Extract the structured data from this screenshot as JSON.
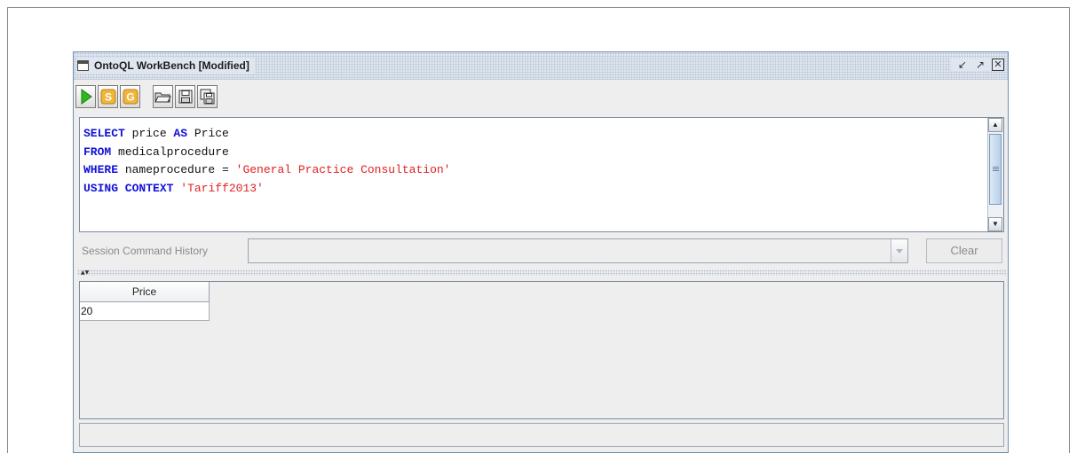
{
  "window": {
    "title": "OntoQL WorkBench [Modified]",
    "controls": {
      "minimize_icon": "restore-down-icon",
      "maximize_icon": "maximize-icon",
      "close_icon": "close-icon"
    }
  },
  "toolbar": {
    "buttons": [
      {
        "icon": "run-icon",
        "letter": ""
      },
      {
        "icon": "s-badge-icon",
        "letter": "S"
      },
      {
        "icon": "g-badge-icon",
        "letter": "G"
      },
      {
        "icon": "open-folder-icon",
        "letter": ""
      },
      {
        "icon": "save-icon",
        "letter": ""
      },
      {
        "icon": "save-as-icon",
        "letter": ""
      }
    ]
  },
  "editor": {
    "lines": [
      [
        {
          "t": "kw",
          "v": "SELECT"
        },
        {
          "t": "id",
          "v": " price "
        },
        {
          "t": "kw",
          "v": "AS"
        },
        {
          "t": "id",
          "v": " Price"
        }
      ],
      [
        {
          "t": "kw",
          "v": "FROM"
        },
        {
          "t": "id",
          "v": " medicalprocedure"
        }
      ],
      [
        {
          "t": "kw",
          "v": "WHERE"
        },
        {
          "t": "id",
          "v": " nameprocedure = "
        },
        {
          "t": "str",
          "v": "'General Practice Consultation'"
        }
      ],
      [
        {
          "t": "kw",
          "v": "USING CONTEXT"
        },
        {
          "t": "id",
          "v": " "
        },
        {
          "t": "str",
          "v": "'Tariff2013'"
        }
      ]
    ],
    "colors": {
      "keyword": "#1212d8",
      "string": "#e02020",
      "identifier": "#111111"
    }
  },
  "history": {
    "label": "Session Command History",
    "selected": "",
    "clear_label": "Clear"
  },
  "results": {
    "columns": [
      "Price"
    ],
    "rows": [
      [
        "20"
      ]
    ]
  },
  "status": {
    "text": ""
  }
}
